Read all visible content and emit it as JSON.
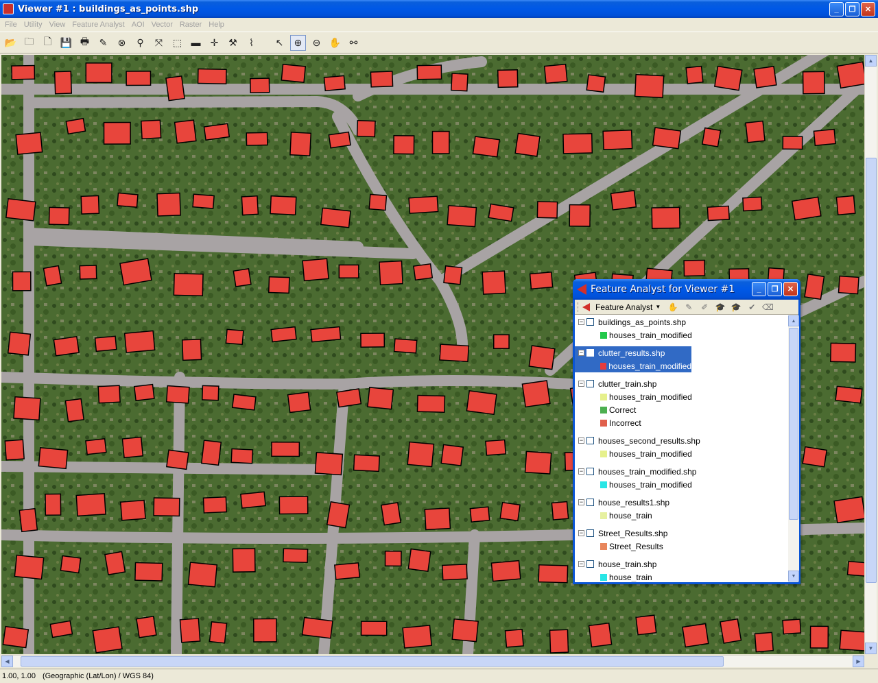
{
  "window": {
    "title": "Viewer #1 : buildings_as_points.shp",
    "minimize": "_",
    "restore": "❐",
    "close": "✕"
  },
  "menu": [
    "File",
    "Utility",
    "View",
    "Feature Analyst",
    "AOI",
    "Vector",
    "Raster",
    "Help"
  ],
  "toolbar_icons": [
    "open-folder-icon",
    "open-layer-icon",
    "new-icon",
    "save-icon",
    "print-icon",
    "eraser-icon",
    "clear-icon",
    "inquire-icon",
    "fit-icon",
    "zoom-extent-icon",
    "measure-icon",
    "crosshair-icon",
    "arrange-icon",
    "profile-icon",
    "select-arrow-icon",
    "zoom-in-icon",
    "zoom-out-icon",
    "pan-icon",
    "link-icon"
  ],
  "status": {
    "coords": "1.00, 1.00",
    "projection": "(Geographic (Lat/Lon) / WGS 84)"
  },
  "feature_analyst": {
    "title": "Feature Analyst for Viewer #1",
    "menu_label": "Feature Analyst",
    "layers": [
      {
        "name": "buildings_as_points.shp",
        "checked": false,
        "selected": false,
        "legend": [
          {
            "label": "houses_train_modified",
            "color": "#22c84a"
          }
        ]
      },
      {
        "name": "clutter_results.shp",
        "checked": true,
        "selected": true,
        "legend": [
          {
            "label": "houses_train_modified",
            "color": "#e83c3c"
          }
        ]
      },
      {
        "name": "clutter_train.shp",
        "checked": false,
        "selected": false,
        "legend": [
          {
            "label": "houses_train_modified",
            "color": "#e6f08c"
          },
          {
            "label": "Correct",
            "color": "#4caf50"
          },
          {
            "label": "Incorrect",
            "color": "#e0604c"
          }
        ]
      },
      {
        "name": "houses_second_results.shp",
        "checked": false,
        "selected": false,
        "legend": [
          {
            "label": "houses_train_modified",
            "color": "#e6f08c"
          }
        ]
      },
      {
        "name": "houses_train_modified.shp",
        "checked": false,
        "selected": false,
        "legend": [
          {
            "label": "houses_train_modified",
            "color": "#29e6e6"
          }
        ]
      },
      {
        "name": "house_results1.shp",
        "checked": false,
        "selected": false,
        "legend": [
          {
            "label": "house_train",
            "color": "#e6f0a0"
          }
        ]
      },
      {
        "name": "Street_Results.shp",
        "checked": false,
        "selected": false,
        "legend": [
          {
            "label": "Street_Results",
            "color": "#e8865c"
          }
        ]
      },
      {
        "name": "house_train.shp",
        "checked": false,
        "selected": false,
        "legend": [
          {
            "label": "house_train",
            "color": "#29e6e6"
          }
        ]
      }
    ]
  },
  "colors": {
    "building_fill": "#e8453c",
    "building_outline": "#000000",
    "road": "#a49fa0",
    "lawn": "#4a6a30"
  }
}
